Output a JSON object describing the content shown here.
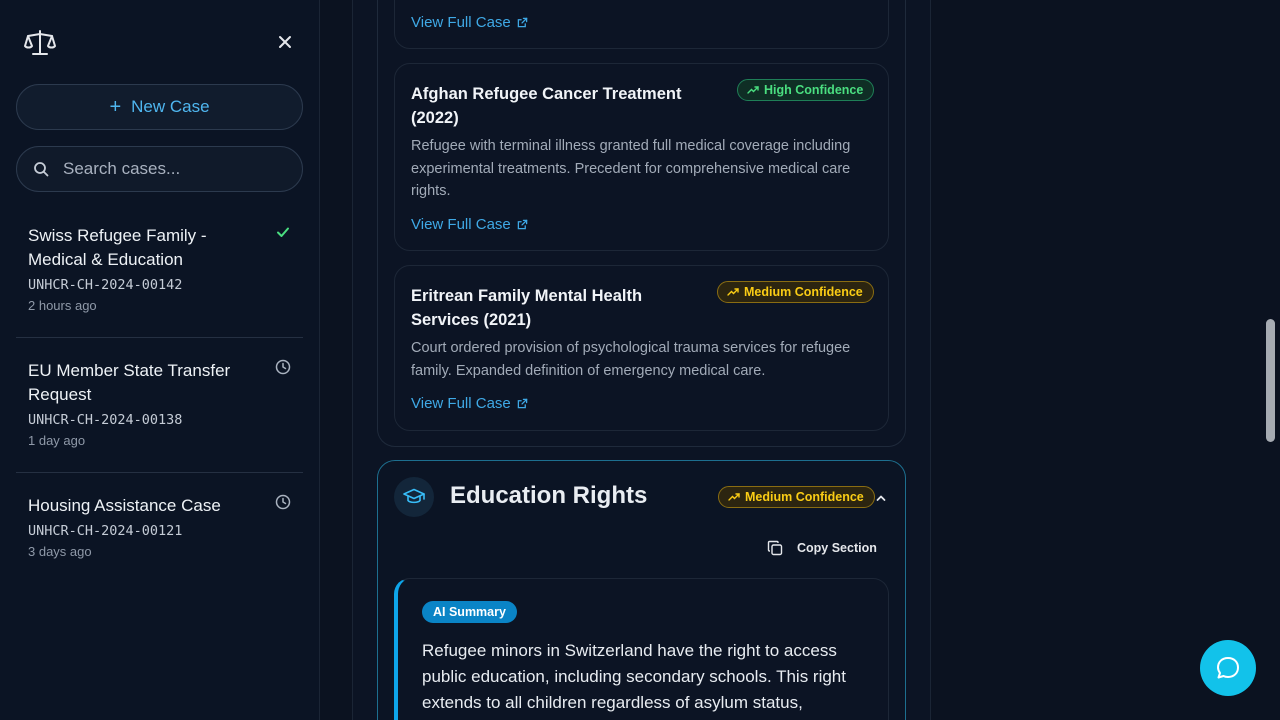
{
  "sidebar": {
    "new_case_label": "New Case",
    "search_placeholder": "Search cases...",
    "cases": [
      {
        "title": "Swiss Refugee Family - Medical & Education",
        "id": "UNHCR-CH-2024-00142",
        "time": "2 hours ago",
        "status": "check-icon"
      },
      {
        "title": "EU Member State Transfer Request",
        "id": "UNHCR-CH-2024-00138",
        "time": "1 day ago",
        "status": "clock-icon"
      },
      {
        "title": "Housing Assistance Case",
        "id": "UNHCR-CH-2024-00121",
        "time": "3 days ago",
        "status": "clock-icon"
      }
    ]
  },
  "precedents": {
    "top_link": "View Full Case",
    "items": [
      {
        "title": "Afghan Refugee Cancer Treatment (2022)",
        "confidence": "High Confidence",
        "description": "Refugee with terminal illness granted full medical coverage including experimental treatments. Precedent for comprehensive medical care rights.",
        "link": "View Full Case"
      },
      {
        "title": "Eritrean Family Mental Health Services (2021)",
        "confidence": "Medium Confidence",
        "description": "Court ordered provision of psychological trauma services for refugee family. Expanded definition of emergency medical care.",
        "link": "View Full Case"
      }
    ]
  },
  "education": {
    "title": "Education Rights",
    "confidence": "Medium Confidence",
    "copy_label": "Copy Section",
    "ai_badge": "AI Summary",
    "summary": "Refugee minors in Switzerland have the right to access public education, including secondary schools. This right extends to all children regardless of asylum status,"
  },
  "colors": {
    "accent": "#0ea5e9",
    "high": "#4ade80",
    "medium": "#facc15",
    "link": "#3fa9e6"
  }
}
